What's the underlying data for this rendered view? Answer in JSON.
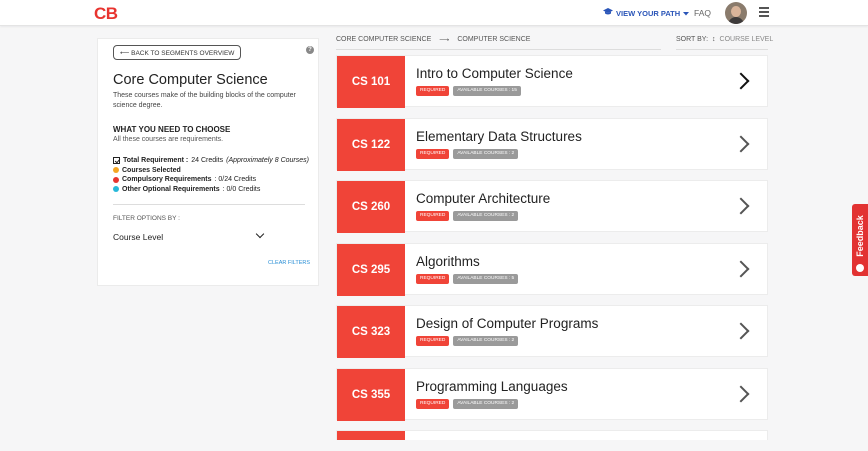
{
  "header": {
    "logo": "CB",
    "path_label": "VIEW YOUR PATH",
    "faq": "FAQ"
  },
  "panel": {
    "back_label": "⟵ BACK TO SEGMENTS OVERVIEW",
    "help": "?",
    "title": "Core Computer Science",
    "description": "These courses make of the building blocks of the computer science degree.",
    "choose_heading": "WHAT YOU NEED TO CHOOSE",
    "choose_sub": "All these courses are requirements.",
    "total_label": "Total Requirement :",
    "total_value": "24 Credits",
    "total_note": "(Approximately 8 Courses)",
    "selected_label": "Courses Selected",
    "compulsory_label": "Compulsory Requirements",
    "compulsory_value": ": 0/24 Credits",
    "optional_label": "Other Optional Requirements",
    "optional_value": ": 0/0 Credits",
    "filter_label": "FILTER OPTIONS BY :",
    "filter_value": "Course Level",
    "clear_filters": "CLEAR FILTERS"
  },
  "breadcrumb": {
    "first": "CORE COMPUTER SCIENCE",
    "arrow": "⟶",
    "second": "COMPUTER SCIENCE"
  },
  "sort": {
    "label": "SORT BY:",
    "icon": "↕",
    "value": "COURSE LEVEL"
  },
  "courses": [
    {
      "code": "CS 101",
      "name": "Intro to Computer Science",
      "required": "REQUIRED",
      "available": "AVAILABLE COURSES : 15"
    },
    {
      "code": "CS 122",
      "name": "Elementary Data Structures",
      "required": "REQUIRED",
      "available": "AVAILABLE COURSES : 2"
    },
    {
      "code": "CS 260",
      "name": "Computer Architecture",
      "required": "REQUIRED",
      "available": "AVAILABLE COURSES : 2"
    },
    {
      "code": "CS 295",
      "name": "Algorithms",
      "required": "REQUIRED",
      "available": "AVAILABLE COURSES : 5"
    },
    {
      "code": "CS 323",
      "name": "Design of Computer Programs",
      "required": "REQUIRED",
      "available": "AVAILABLE COURSES : 2"
    },
    {
      "code": "CS 355",
      "name": "Programming Languages",
      "required": "REQUIRED",
      "available": "AVAILABLE COURSES : 2"
    }
  ],
  "feedback": "Feedback",
  "colors": {
    "accent_red": "#f04438",
    "link_blue": "#2a55b8",
    "selected_orange": "#f5a623",
    "compulsory_red": "#e8342f",
    "optional_cyan": "#27b8d9",
    "tag_gray": "#9a9a9a"
  },
  "icons": {
    "path": "graduation-cap-icon",
    "path_caret": "caret-down-icon",
    "menu": "hamburger-menu-icon",
    "help": "question-circle-icon",
    "filter": "chevron-down-icon",
    "card": "chevron-right-icon",
    "sort": "sort-arrows-icon"
  }
}
